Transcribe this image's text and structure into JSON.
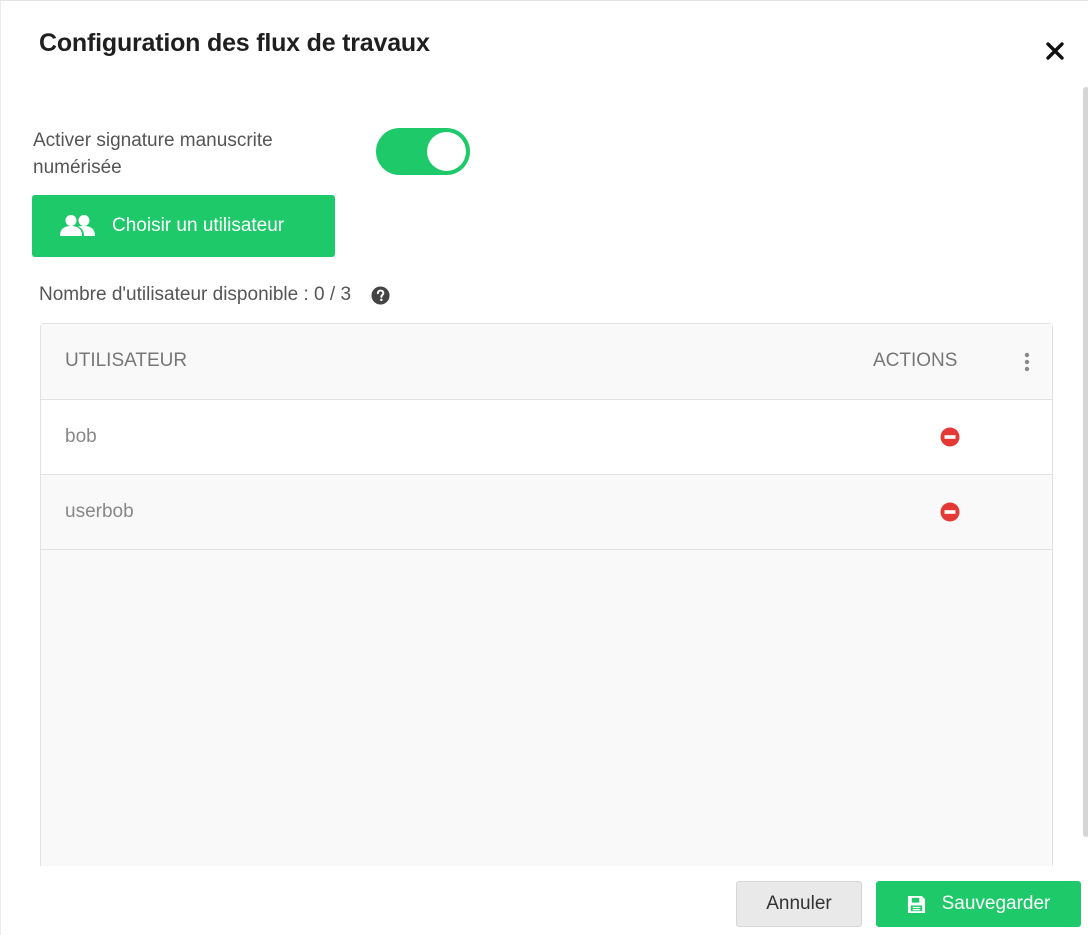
{
  "dialog": {
    "title": "Configuration des flux de travaux",
    "close_icon": "close-icon"
  },
  "signature_toggle": {
    "label": "Activer signature manuscrite numérisée",
    "enabled": true,
    "color": "#1ec96a"
  },
  "choose_user_button": {
    "label": "Choisir un utilisateur",
    "icon": "users-icon"
  },
  "available_users": {
    "text": "Nombre d'utilisateur disponible : 0 / 3",
    "icon": "help-circle-icon"
  },
  "table": {
    "columns": {
      "user": "UTILISATEUR",
      "actions": "ACTIONS"
    },
    "menu_icon": "kebab-menu-icon",
    "rows": [
      {
        "user": "bob",
        "action_icon": "remove-icon"
      },
      {
        "user": "userbob",
        "action_icon": "remove-icon"
      }
    ],
    "remove_color": "#e53935"
  },
  "footer": {
    "cancel_label": "Annuler",
    "save_label": "Sauvegarder",
    "save_icon": "floppy-disk-icon"
  },
  "colors": {
    "accent": "#1ec96a",
    "danger": "#e53935"
  }
}
